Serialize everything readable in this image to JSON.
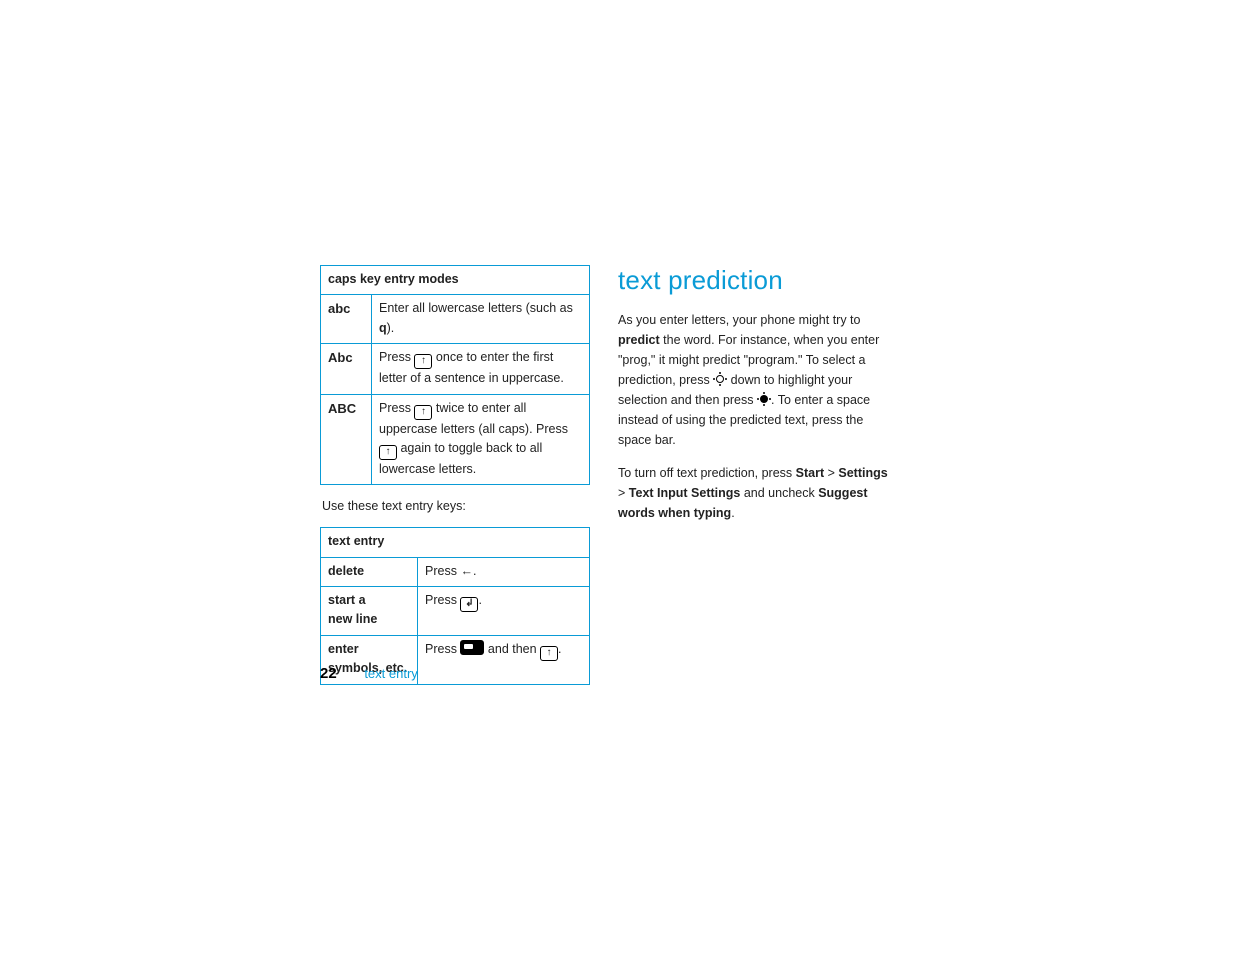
{
  "left": {
    "table1": {
      "header": "caps key entry modes",
      "rows": [
        {
          "mode": "abc",
          "desc_a": "Enter all lowercase letters (such as ",
          "desc_bold": "q",
          "desc_b": ")."
        },
        {
          "mode": "Abc",
          "desc_a": "Press ",
          "desc_b": " once to enter the first letter of a sentence in uppercase."
        },
        {
          "mode": "ABC",
          "desc_a": "Press ",
          "desc_b": " twice to enter all uppercase letters (all caps). Press ",
          "desc_c": " again to toggle back to all lowercase letters."
        }
      ]
    },
    "intertext": "Use these text entry keys:",
    "table2": {
      "header": "text entry",
      "rows": [
        {
          "label": "delete",
          "a": "Press ",
          "b": "."
        },
        {
          "label_a": "start a",
          "label_b": "new line",
          "a": "Press ",
          "b": "."
        },
        {
          "label_a": "enter",
          "label_b": "symbols, etc.",
          "a": "Press ",
          "mid": " and then ",
          "b": "."
        }
      ]
    }
  },
  "right": {
    "heading": "text prediction",
    "p1_a": "As you enter letters, your phone might try to ",
    "p1_bold": "predict",
    "p1_b": " the word. For instance, when you enter \"prog,\" it might predict \"program.\" To select a prediction, press ",
    "p1_c": " down to highlight your selection and then press ",
    "p1_d": ". To enter a space instead of using the predicted text, press the space bar.",
    "p2_a": "To turn off text prediction, press ",
    "menu1": "Start",
    "gt": " > ",
    "menu2": "Settings",
    "menu3": "Text Input Settings",
    "p2_b": " and uncheck ",
    "menu4": "Suggest words when typing",
    "p2_c": "."
  },
  "footer": {
    "page": "22",
    "section": "text entry"
  },
  "glyphs": {
    "shift": "↑",
    "back": "←",
    "enter": "↲"
  }
}
